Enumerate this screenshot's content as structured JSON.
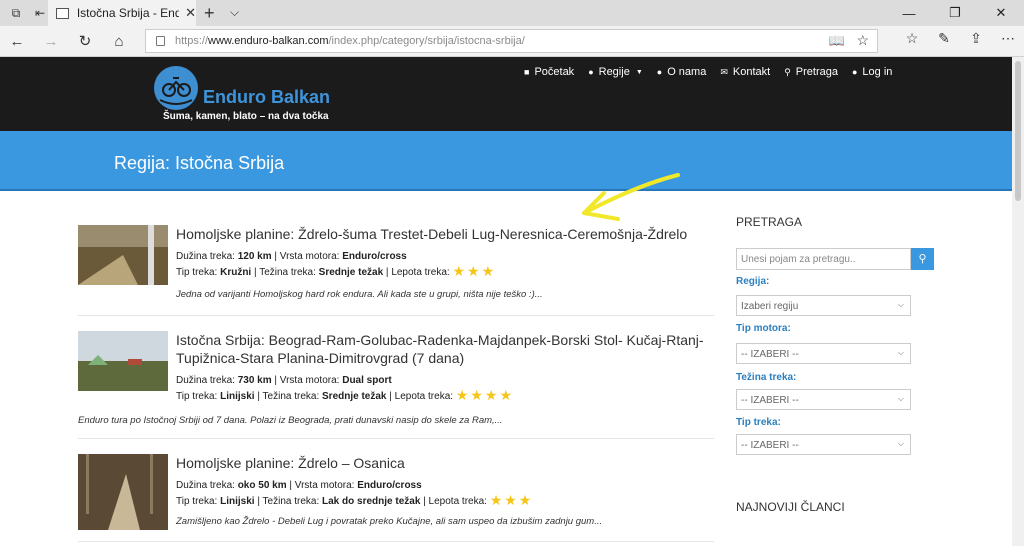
{
  "browser": {
    "tab_title": "Istočna Srbija - Enduro B",
    "tab_close": "✕",
    "url_prefix": "https://",
    "url_domain": "www.enduro-balkan.com",
    "url_path": "/index.php/category/srbija/istocna-srbija/"
  },
  "site": {
    "brand": "Enduro Balkan",
    "tagline": "Šuma, kamen, blato – na dva točka",
    "nav": [
      "Početak",
      "Regije",
      "O nama",
      "Kontakt",
      "Pretraga",
      "Log in"
    ],
    "page_title": "Regija: Istočna Srbija"
  },
  "articles": [
    {
      "title": "Homoljske planine: Ždrelo-šuma Trestet-Debeli Lug-Neresnica-Ceremošnja-Ždrelo",
      "len_label": "Dužina treka:",
      "len": "120 km",
      "moto_label": "Vrsta motora:",
      "moto": "Enduro/cross",
      "type_label": "Tip treka:",
      "type": "Kružni",
      "diff_label": "Težina treka:",
      "diff": "Srednje težak",
      "beauty_label": "Lepota treka:",
      "stars": "★★★",
      "desc": "Jedna od varijanti Homoljskog hard rok endura. Ali kada ste u grupi, ništa nije teško :)..."
    },
    {
      "title": "Istočna Srbija: Beograd-Ram-Golubac-Radenka-Majdanpek-Borski Stol- Kučaj-Rtanj-Tupižnica-Stara Planina-Dimitrovgrad (7 dana)",
      "len_label": "Dužina treka:",
      "len": "730 km",
      "moto_label": "Vrsta motora:",
      "moto": "Dual sport",
      "type_label": "Tip treka:",
      "type": "Linijski",
      "diff_label": "Težina treka:",
      "diff": "Srednje težak",
      "beauty_label": "Lepota treka:",
      "stars": "★★★★",
      "desc": "Enduro tura po Istočnoj Srbiji od 7 dana. Polazi iz Beograda, prati dunavski nasip do skele za Ram,..."
    },
    {
      "title": "Homoljske planine: Ždrelo – Osanica",
      "len_label": "Dužina treka:",
      "len": "oko 50 km",
      "moto_label": "Vrsta motora:",
      "moto": "Enduro/cross",
      "type_label": "Tip treka:",
      "type": "Linijski",
      "diff_label": "Težina treka:",
      "diff": "Lak do srednje težak",
      "beauty_label": "Lepota treka:",
      "stars": "★★★",
      "desc": "Zamišljeno kao Ždrelo - Debeli Lug i povratak preko Kučajne, ali sam uspeo da izbušim zadnju gum..."
    }
  ],
  "sidebar": {
    "heading": "PRETRAGA",
    "search_placeholder": "Unesi pojam za pretragu..",
    "region_label": "Regija:",
    "region_value": "Izaberi regiju",
    "moto_label": "Tip motora:",
    "moto_value": "-- IZABERI --",
    "diff_label": "Težina treka:",
    "diff_value": "-- IZABERI --",
    "type_label": "Tip treka:",
    "type_value": "-- IZABERI --",
    "latest_heading": "NAJNOVIJI ČLANCI"
  }
}
